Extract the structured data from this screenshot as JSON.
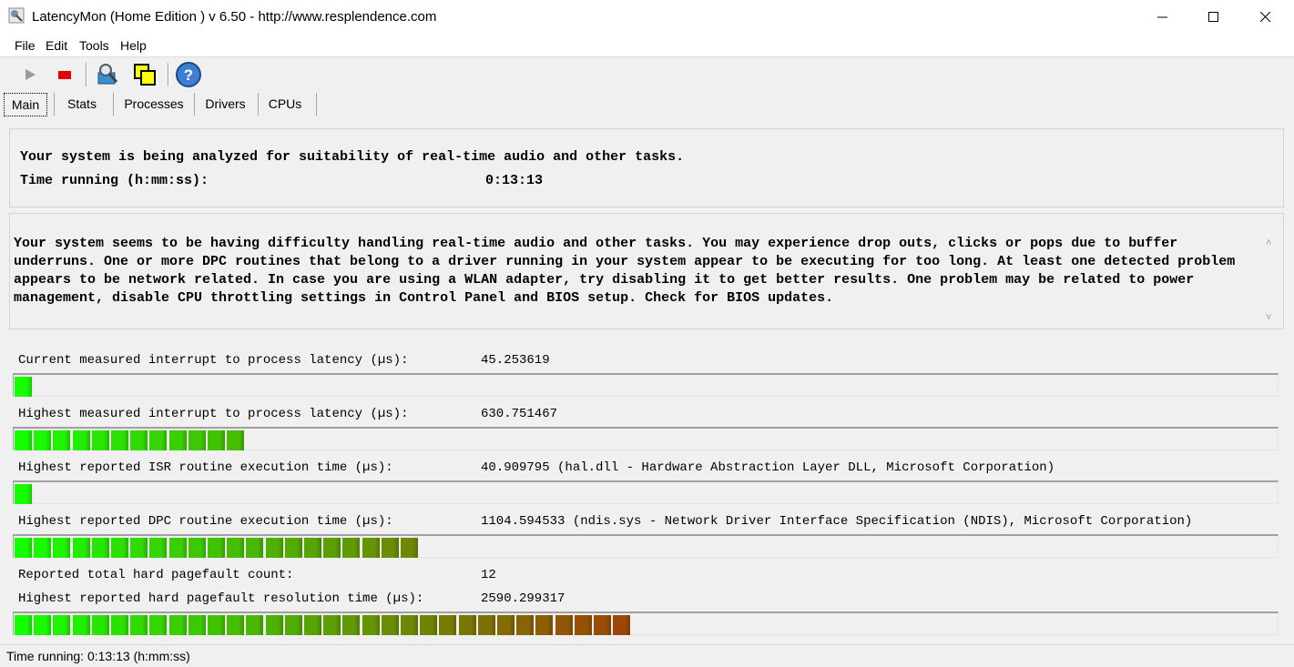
{
  "window": {
    "title": "LatencyMon  (Home Edition )  v 6.50 - http://www.resplendence.com",
    "icons": [
      "app-icon",
      "minimize-icon",
      "maximize-icon",
      "close-icon"
    ]
  },
  "menu": [
    "File",
    "Edit",
    "Tools",
    "Help"
  ],
  "toolbar": {
    "icons": [
      "play-icon",
      "stop-icon",
      "driver-search-icon",
      "cpu-windows-icon",
      "help-icon"
    ]
  },
  "tabs": [
    "Main",
    "Stats",
    "Processes",
    "Drivers",
    "CPUs"
  ],
  "analysis": {
    "status": "Your system is being analyzed for suitability of real-time audio and other tasks.",
    "time_label": "Time running (h:mm:ss):",
    "time_value": "0:13:13"
  },
  "message": "Your system seems to be having difficulty handling real-time audio and other tasks. You may experience drop outs, clicks or pops due to buffer underruns. One or more DPC routines that belong to a driver running in your system appear to be executing for too long. At least one detected problem appears to be network related. In case you are using a WLAN adapter, try disabling it to get better results. One problem may be related to power management, disable CPU throttling settings in Control Panel and BIOS setup. Check for BIOS updates.",
  "metrics": [
    {
      "label": "Current measured interrupt to process latency (µs):",
      "value": "45.253619",
      "segments": 1
    },
    {
      "label": "Highest measured interrupt to process latency (µs):",
      "value": "630.751467",
      "segments": 12
    },
    {
      "label": "Highest reported ISR routine execution time (µs):",
      "value": "40.909795   (hal.dll - Hardware Abstraction Layer DLL, Microsoft Corporation)",
      "segments": 1
    },
    {
      "label": "Highest reported DPC routine execution time (µs):",
      "value": "1104.594533   (ndis.sys - Network Driver Interface Specification (NDIS), Microsoft Corporation)",
      "segments": 21
    },
    {
      "label": "Reported total hard pagefault count:",
      "value": "12"
    },
    {
      "label": "Highest reported hard pagefault resolution time (µs):",
      "value": "2590.299317",
      "segments": 32
    }
  ],
  "colors": {
    "bar_start": "#16ff00",
    "bar_end": "#a63a07"
  },
  "statusbar": "Time running: 0:13:13  (h:mm:ss)"
}
